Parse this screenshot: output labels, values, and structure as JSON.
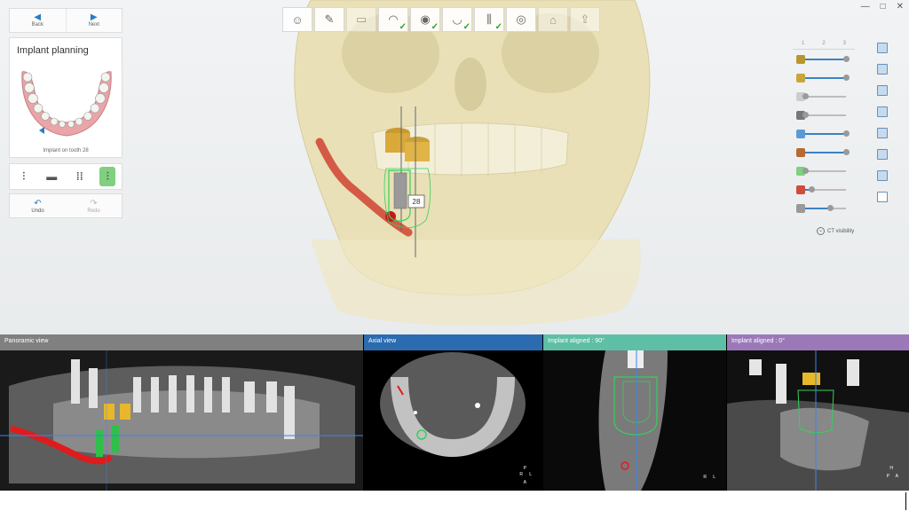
{
  "window": {
    "controls": [
      "—",
      "□",
      "✕"
    ]
  },
  "workflow": {
    "steps": [
      {
        "icon": "patient-icon",
        "done": false,
        "active": true
      },
      {
        "icon": "prescription-icon",
        "done": false,
        "active": true
      },
      {
        "icon": "scan-icon",
        "done": false,
        "active": false
      },
      {
        "icon": "upper-jaw-icon",
        "done": true,
        "active": true
      },
      {
        "icon": "crown-icon",
        "done": true,
        "active": true
      },
      {
        "icon": "lower-jaw-icon",
        "done": true,
        "active": true
      },
      {
        "icon": "implant-icon",
        "done": true,
        "active": true
      },
      {
        "icon": "guide-icon",
        "done": false,
        "active": true
      },
      {
        "icon": "sleeve-icon",
        "done": false,
        "active": false
      },
      {
        "icon": "export-icon",
        "done": false,
        "active": false
      }
    ]
  },
  "nav": {
    "back": "Back",
    "next": "Next"
  },
  "plan": {
    "title": "Implant planning",
    "caption": "Implant on tooth 28"
  },
  "implant_types": [
    {
      "icon": "single-implant-icon",
      "active": false
    },
    {
      "icon": "sleeve-component-icon",
      "active": false
    },
    {
      "icon": "multi-implant-icon",
      "active": false
    },
    {
      "icon": "selected-implant-icon",
      "active": true
    }
  ],
  "history": {
    "undo": "Undo",
    "redo": "Redo"
  },
  "right_panel": {
    "tabs": [
      "1",
      "2",
      "3"
    ],
    "sliders": [
      {
        "icon": "abutment-icon",
        "level": 1.0
      },
      {
        "icon": "crown-visibility-icon",
        "level": 1.0
      },
      {
        "icon": "gingiva-icon",
        "level": 0.0
      },
      {
        "icon": "jaw-visibility-icon",
        "level": 0.0
      },
      {
        "icon": "sleeve-visibility-icon",
        "level": 1.0
      },
      {
        "icon": "implant-visibility-icon",
        "level": 1.0
      },
      {
        "icon": "nerve-visibility-icon",
        "level": 0.0
      },
      {
        "icon": "scissors-icon",
        "level": 0.15
      },
      {
        "icon": "ct-threshold-icon",
        "level": 0.6
      }
    ],
    "ct_visibility": "CT visibility"
  },
  "scene": {
    "tooth_label": "28"
  },
  "views": [
    {
      "title": "Panoramic view",
      "header_color": "#808080"
    },
    {
      "title": "Axial view",
      "header_color": "#2b6cb0",
      "orientation": [
        "P",
        "R",
        "L",
        "A"
      ]
    },
    {
      "title": "Implant aligned : 90°",
      "header_color": "#5fbfa6",
      "orientation": [
        "R",
        "L"
      ]
    },
    {
      "title": "Implant aligned : 0°",
      "header_color": "#9b79b8",
      "orientation": [
        "H",
        "P",
        "A"
      ]
    }
  ],
  "colors": {
    "bone": "#e8dfb6",
    "nerve": "#e0513f",
    "implant_outline": "#36d05a",
    "accent": "#2b7cc4"
  }
}
